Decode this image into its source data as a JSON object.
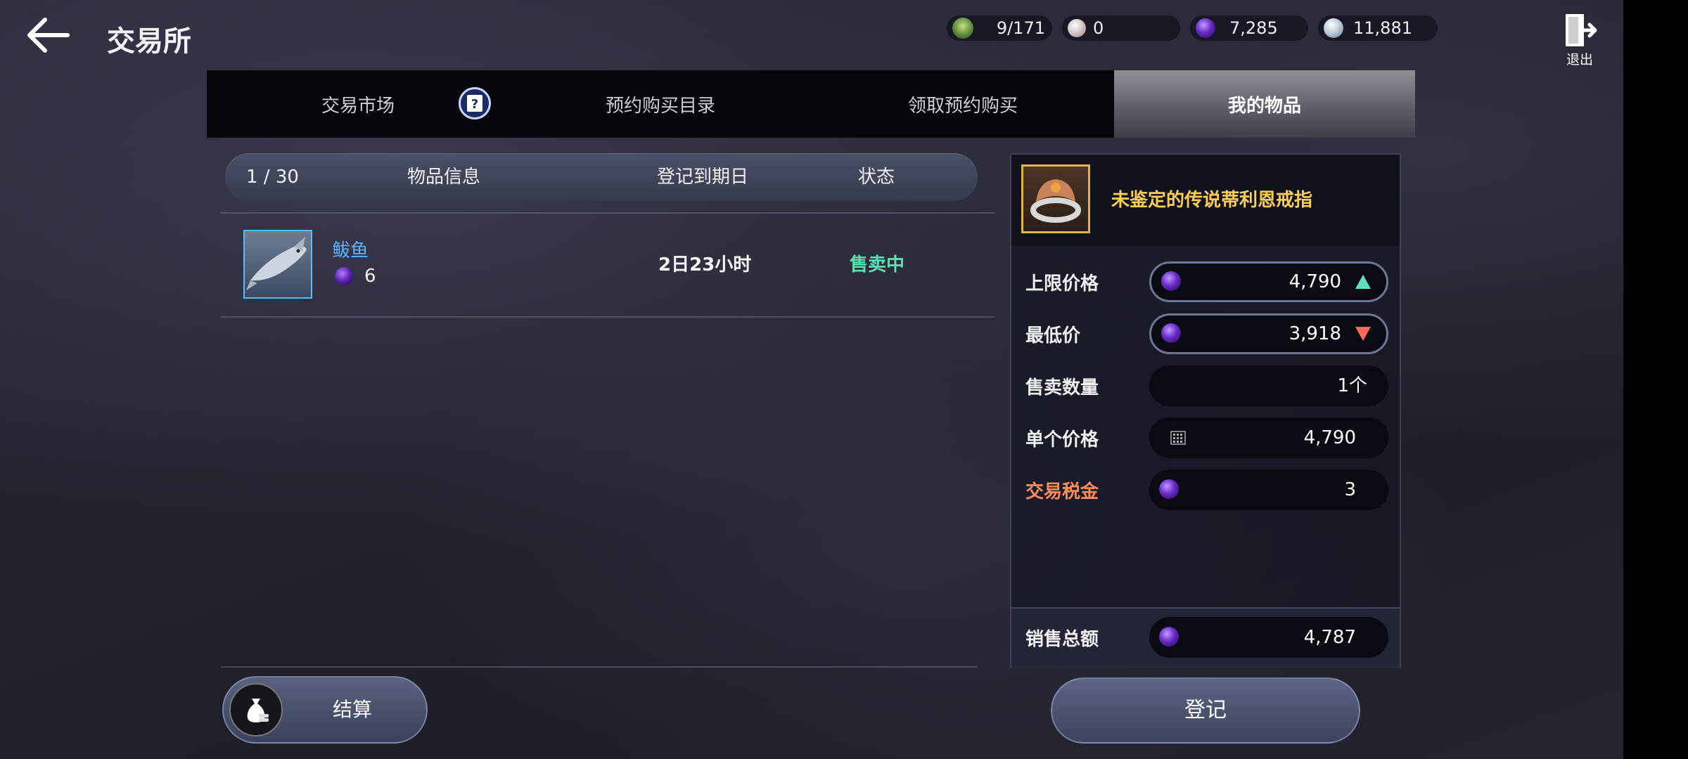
{
  "header": {
    "title": "交易所",
    "exit_label": "退出",
    "currencies": [
      {
        "icon": "weight-capacity-icon",
        "value": "9/171"
      },
      {
        "icon": "pearl-icon",
        "value": "0"
      },
      {
        "icon": "purple-crystal-icon",
        "value": "7,285"
      },
      {
        "icon": "silver-coin-icon",
        "value": "11,881"
      }
    ]
  },
  "tabs": [
    {
      "label": "交易市场",
      "active": false
    },
    {
      "label": "预约购买目录",
      "active": false
    },
    {
      "label": "领取预约购买",
      "active": false
    },
    {
      "label": "我的物品",
      "active": true
    }
  ],
  "list": {
    "count": "1 / 30",
    "col_item": "物品信息",
    "col_expiry": "登记到期日",
    "col_status": "状态",
    "rows": [
      {
        "name": "鲅鱼",
        "price": "6",
        "expiry": "2日23小时",
        "status": "售卖中"
      }
    ]
  },
  "settle_label": "结算",
  "panel": {
    "item_title": "未鉴定的传说蒂利恩戒指",
    "max_price_label": "上限价格",
    "max_price": "4,790",
    "min_price_label": "最低价",
    "min_price": "3,918",
    "qty_label": "售卖数量",
    "qty": "1个",
    "unit_price_label": "单个价格",
    "unit_price": "4,790",
    "tax_label": "交易税金",
    "tax": "3",
    "total_label": "销售总额",
    "total": "4,787"
  },
  "register_label": "登记",
  "colors": {
    "accent_blue": "#5fb0ff",
    "status_green": "#5be0b2",
    "title_gold": "#ffcc55",
    "tax_orange": "#ff8a5a",
    "up_arrow": "#5fe0c0",
    "down_arrow": "#ff6a5a"
  }
}
